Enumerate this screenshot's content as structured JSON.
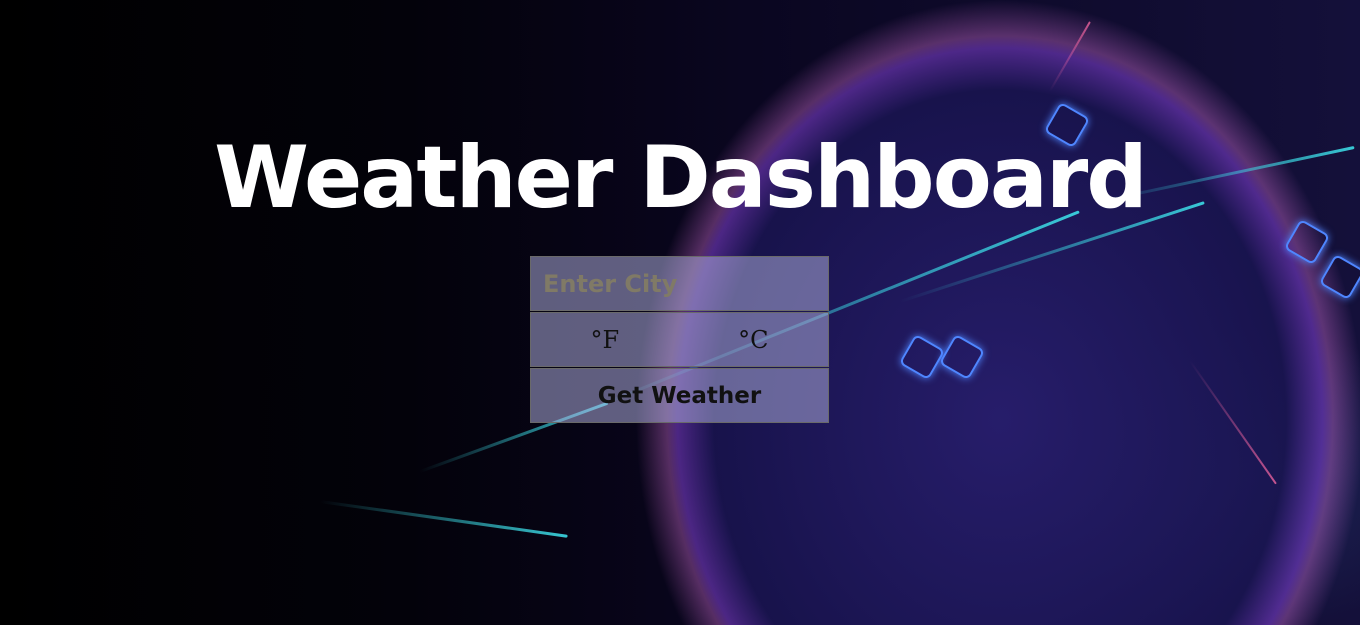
{
  "header": {
    "title": "Weather Dashboard"
  },
  "form": {
    "city_placeholder": "Enter City",
    "unit_fahrenheit": "°F",
    "unit_celsius": "°C",
    "submit_label": "Get Weather"
  },
  "colors": {
    "title": "#ffffff",
    "accent_cyan": "#3cdce6",
    "accent_blue": "#4f86ff"
  }
}
